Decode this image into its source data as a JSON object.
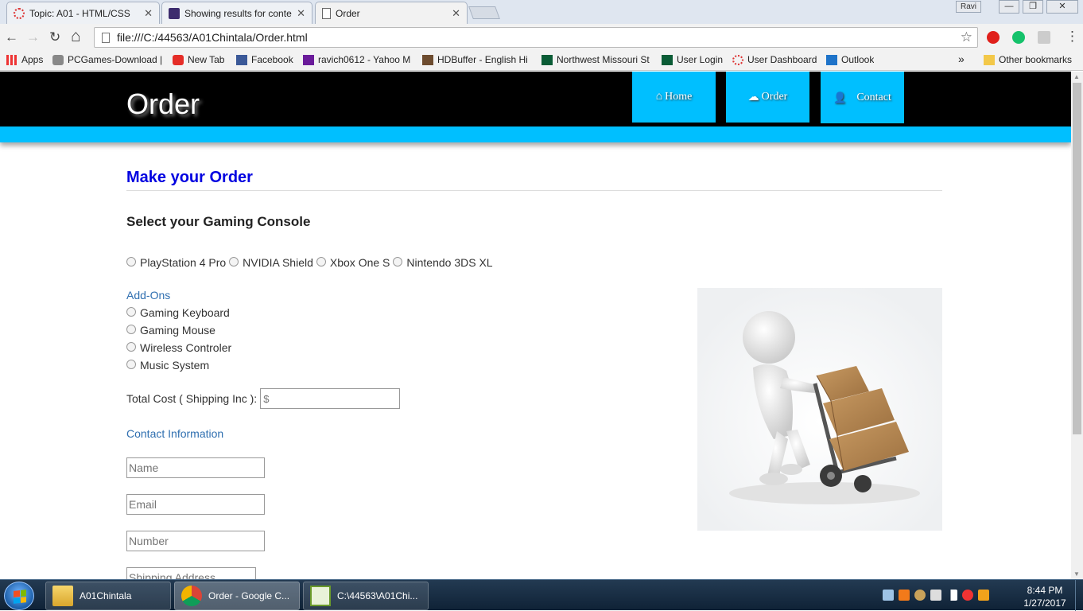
{
  "browser": {
    "tabs": [
      {
        "title": "Topic: A01 - HTML/CSS",
        "close": "✕"
      },
      {
        "title": "Showing results for conte",
        "close": "✕"
      },
      {
        "title": "Order",
        "close": "✕"
      }
    ],
    "user_button": "Ravi",
    "window_buttons": {
      "minimize": "—",
      "restore": "❐",
      "close": "✕"
    },
    "nav": {
      "back": "←",
      "forward": "→",
      "reload": "↻",
      "home": "⌂"
    },
    "address": "file:///C:/44563/A01Chintala/Order.html",
    "star": "☆",
    "menu": "⋮",
    "bookmarks": [
      {
        "label": "Apps"
      },
      {
        "label": "PCGames-Download |"
      },
      {
        "label": "New Tab"
      },
      {
        "label": "Facebook"
      },
      {
        "label": "ravich0612 - Yahoo M"
      },
      {
        "label": "HDBuffer - English Hi"
      },
      {
        "label": "Northwest Missouri St"
      },
      {
        "label": "User Login"
      },
      {
        "label": "User Dashboard"
      },
      {
        "label": "Outlook"
      }
    ],
    "bookmarks_overflow": "»",
    "other_bookmarks": "Other bookmarks"
  },
  "site": {
    "title": "Order",
    "nav": [
      {
        "icon": "⌂",
        "label": "Home"
      },
      {
        "icon": "☁",
        "label": "Order"
      },
      {
        "icon": "👤",
        "label": "Contact"
      }
    ]
  },
  "form": {
    "heading": "Make your Order",
    "console_heading": "Select your Gaming Console",
    "consoles": [
      "PlayStation 4 Pro",
      "NVIDIA Shield",
      "Xbox One S",
      "Nintendo 3DS XL"
    ],
    "addons_heading": "Add-Ons",
    "addons": [
      "Gaming Keyboard",
      "Gaming Mouse",
      "Wireless Controler",
      "Music System"
    ],
    "total_cost_label": "Total Cost ( Shipping Inc ):",
    "total_cost_placeholder": "$",
    "contact_heading": "Contact Information",
    "name_placeholder": "Name",
    "email_placeholder": "Email",
    "number_placeholder": "Number",
    "address_placeholder": "Shipping Address"
  },
  "taskbar": {
    "items": [
      {
        "label": "A01Chintala"
      },
      {
        "label": "Order - Google C..."
      },
      {
        "label": "C:\\44563\\A01Chi..."
      }
    ],
    "time": "8:44 PM",
    "date": "1/27/2017"
  },
  "colors": {
    "accent": "#00bfff",
    "heading": "#0000e0",
    "subheading": "#2f6fb0"
  }
}
